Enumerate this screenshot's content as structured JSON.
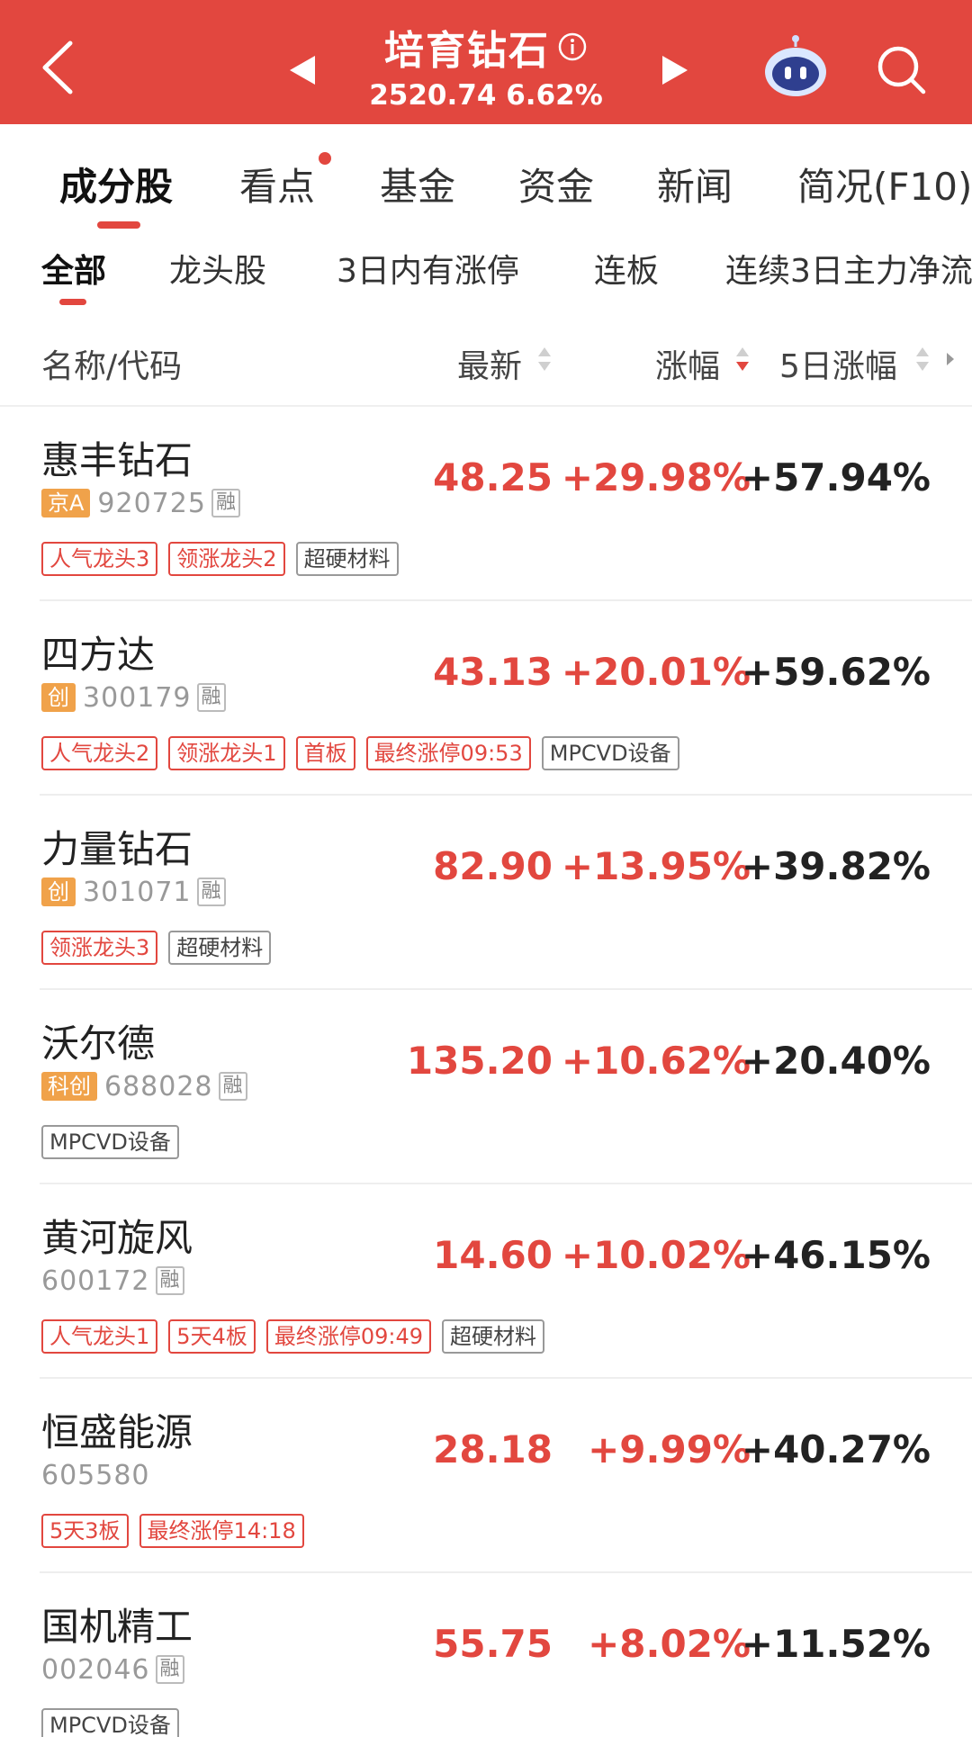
{
  "header": {
    "title": "培育钻石",
    "value": "2520.74",
    "change": "6.62%",
    "accent_color": "#e2473f"
  },
  "main_tabs": [
    "成分股",
    "看点",
    "基金",
    "资金",
    "新闻",
    "简况(F10)"
  ],
  "sub_tabs": [
    "全部",
    "龙头股",
    "3日内有涨停",
    "连板",
    "连续3日主力净流"
  ],
  "columns": {
    "name": "名称/代码",
    "price": "最新",
    "change": "涨幅",
    "change5": "5日涨幅"
  },
  "rows": [
    {
      "name": "惠丰钻石",
      "market": "京A",
      "code": "920725",
      "rong": "融",
      "price": "48.25",
      "change": "+29.98%",
      "change5": "+57.94%",
      "tags": [
        {
          "text": "人气龙头3",
          "style": "red"
        },
        {
          "text": "领涨龙头2",
          "style": "red"
        },
        {
          "text": "超硬材料",
          "style": "gray"
        }
      ]
    },
    {
      "name": "四方达",
      "market": "创",
      "code": "300179",
      "rong": "融",
      "price": "43.13",
      "change": "+20.01%",
      "change5": "+59.62%",
      "tags": [
        {
          "text": "人气龙头2",
          "style": "red"
        },
        {
          "text": "领涨龙头1",
          "style": "red"
        },
        {
          "text": "首板",
          "style": "red"
        },
        {
          "text": "最终涨停09:53",
          "style": "red"
        },
        {
          "text": "MPCVD设备",
          "style": "gray"
        }
      ]
    },
    {
      "name": "力量钻石",
      "market": "创",
      "code": "301071",
      "rong": "融",
      "price": "82.90",
      "change": "+13.95%",
      "change5": "+39.82%",
      "tags": [
        {
          "text": "领涨龙头3",
          "style": "red"
        },
        {
          "text": "超硬材料",
          "style": "gray"
        }
      ]
    },
    {
      "name": "沃尔德",
      "market": "科创",
      "code": "688028",
      "rong": "融",
      "price": "135.20",
      "change": "+10.62%",
      "change5": "+20.40%",
      "tags": [
        {
          "text": "MPCVD设备",
          "style": "gray"
        }
      ]
    },
    {
      "name": "黄河旋风",
      "market": "",
      "code": "600172",
      "rong": "融",
      "price": "14.60",
      "change": "+10.02%",
      "change5": "+46.15%",
      "tags": [
        {
          "text": "人气龙头1",
          "style": "red"
        },
        {
          "text": "5天4板",
          "style": "red"
        },
        {
          "text": "最终涨停09:49",
          "style": "red"
        },
        {
          "text": "超硬材料",
          "style": "gray"
        }
      ]
    },
    {
      "name": "恒盛能源",
      "market": "",
      "code": "605580",
      "rong": "",
      "price": "28.18",
      "change": "+9.99%",
      "change5": "+40.27%",
      "tags": [
        {
          "text": "5天3板",
          "style": "red"
        },
        {
          "text": "最终涨停14:18",
          "style": "red"
        }
      ]
    },
    {
      "name": "国机精工",
      "market": "",
      "code": "002046",
      "rong": "融",
      "price": "55.75",
      "change": "+8.02%",
      "change5": "+11.52%",
      "tags": [
        {
          "text": "MPCVD设备",
          "style": "gray"
        }
      ]
    }
  ]
}
